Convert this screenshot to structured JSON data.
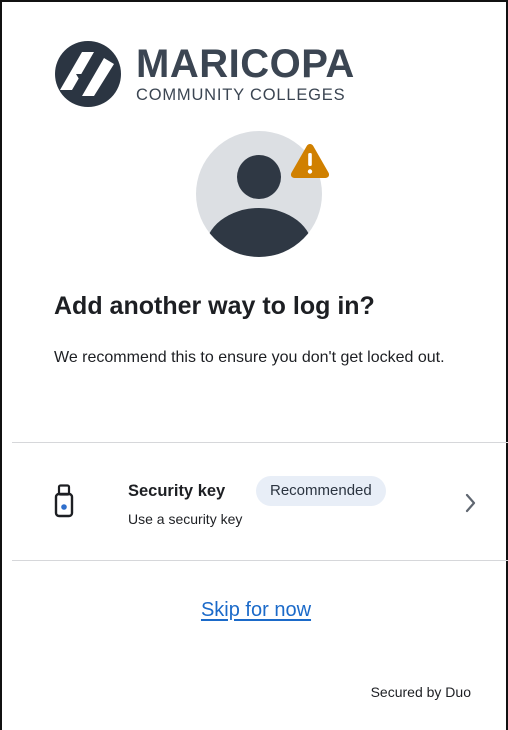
{
  "brand": {
    "name": "MARICOPA",
    "subtitle": "COMMUNITY COLLEGES",
    "logo_icon": "maricopa-logo-icon",
    "text_color": "#3b4552"
  },
  "avatar": {
    "icon": "user-avatar-icon",
    "warning_icon": "warning-triangle-icon",
    "warning_color": "#d08000"
  },
  "heading": {
    "title": "Add another way to log in?",
    "description": "We recommend this to ensure you don't get locked out."
  },
  "option": {
    "icon": "security-key-icon",
    "title": "Security key",
    "badge": "Recommended",
    "subtitle": "Use a security key",
    "chevron_icon": "chevron-right-icon"
  },
  "actions": {
    "skip_label": "Skip for now",
    "link_color": "#1b6ac9"
  },
  "footer": {
    "secured_label": "Secured by Duo"
  }
}
